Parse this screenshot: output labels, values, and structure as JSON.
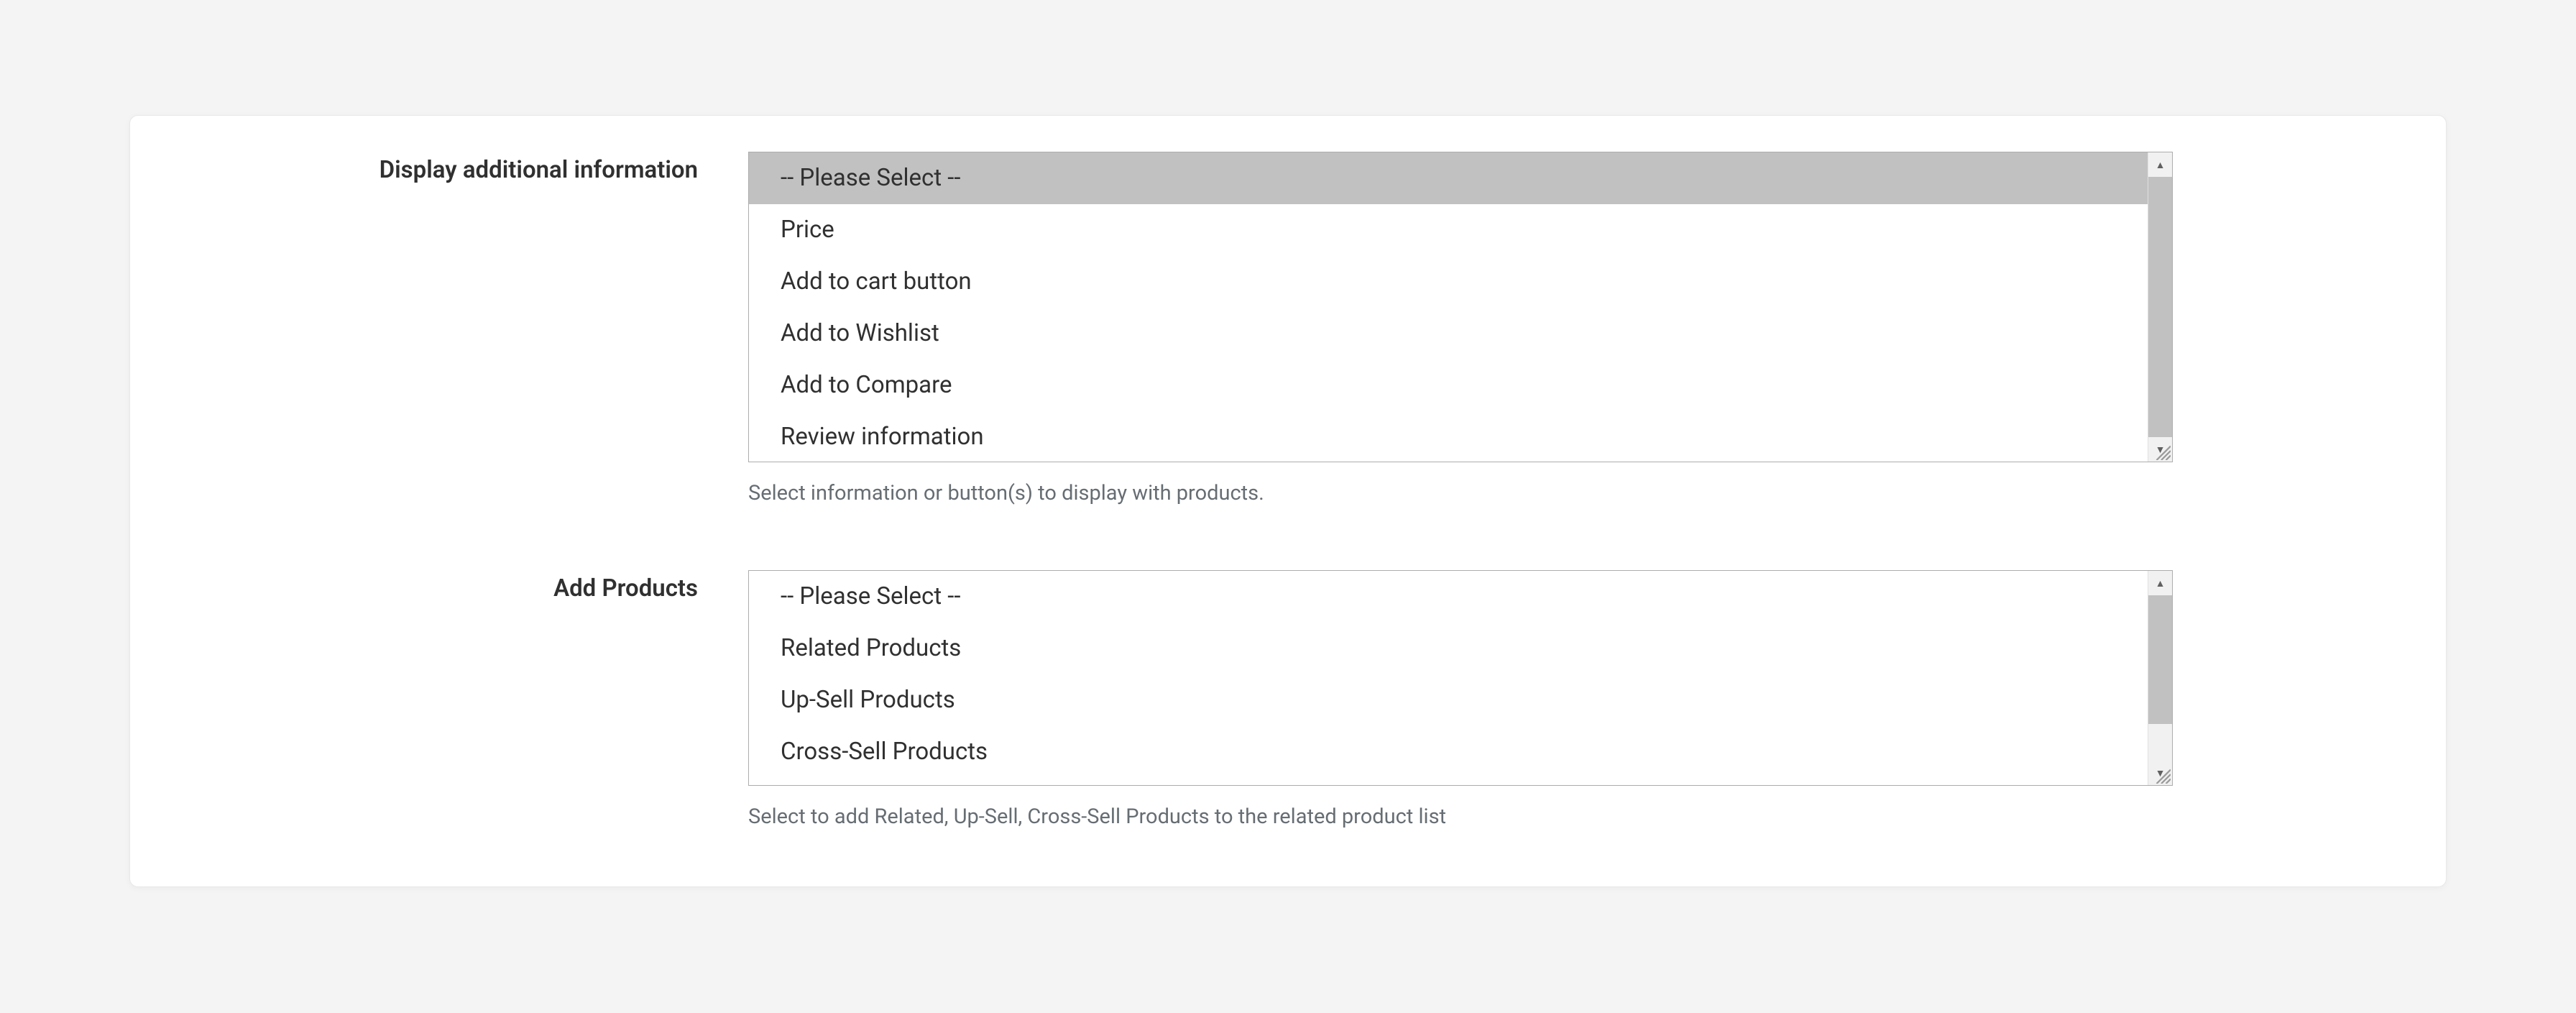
{
  "field_display": {
    "label": "Display additional information",
    "help": "Select information or button(s) to display with products.",
    "options": [
      "-- Please Select --",
      "Price",
      "Add to cart button",
      "Add to Wishlist",
      "Add to Compare",
      "Review information"
    ],
    "selected_index": 0
  },
  "field_add_products": {
    "label": "Add Products",
    "help": "Select to add Related, Up-Sell, Cross-Sell Products to the related product list",
    "options": [
      "-- Please Select --",
      "Related Products",
      "Up-Sell Products",
      "Cross-Sell Products"
    ],
    "selected_index": -1
  }
}
